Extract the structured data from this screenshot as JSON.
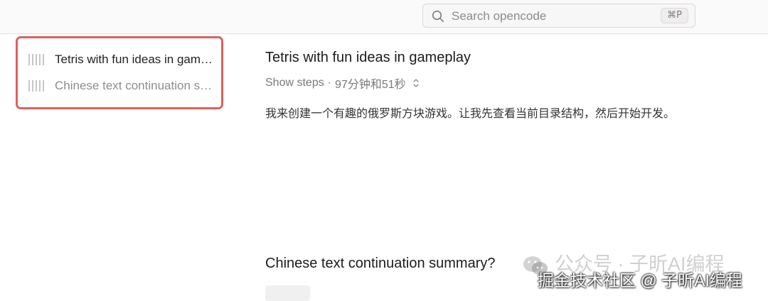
{
  "search": {
    "placeholder": "Search opencode",
    "shortcut": "⌘P",
    "icon": "search-icon"
  },
  "sidebar": {
    "items": [
      {
        "label": "Tetris with fun ideas in gameplay",
        "icon": "bars-icon"
      },
      {
        "label": "Chinese text continuation summary",
        "icon": "bars-icon"
      }
    ]
  },
  "main": {
    "messages": [
      {
        "title": "Tetris with fun ideas in gameplay",
        "steps_label": "Show steps",
        "separator": "·",
        "duration": "97分钟和51秒",
        "body": "我来创建一个有趣的俄罗斯方块游戏。让我先查看当前目录结构，然后开始开发。"
      },
      {
        "title": "Chinese text continuation summary?"
      }
    ]
  },
  "watermark": {
    "line1": "公众号 · 子昕AI编程",
    "line2": "掘金技术社区 @ 子昕AI编程",
    "icon": "wechat-icon"
  },
  "colors": {
    "highlight_border": "#e0605f",
    "topbar_bg": "#fbfafa",
    "text_primary": "#1c1c1c",
    "text_muted": "#8f8c8c"
  }
}
